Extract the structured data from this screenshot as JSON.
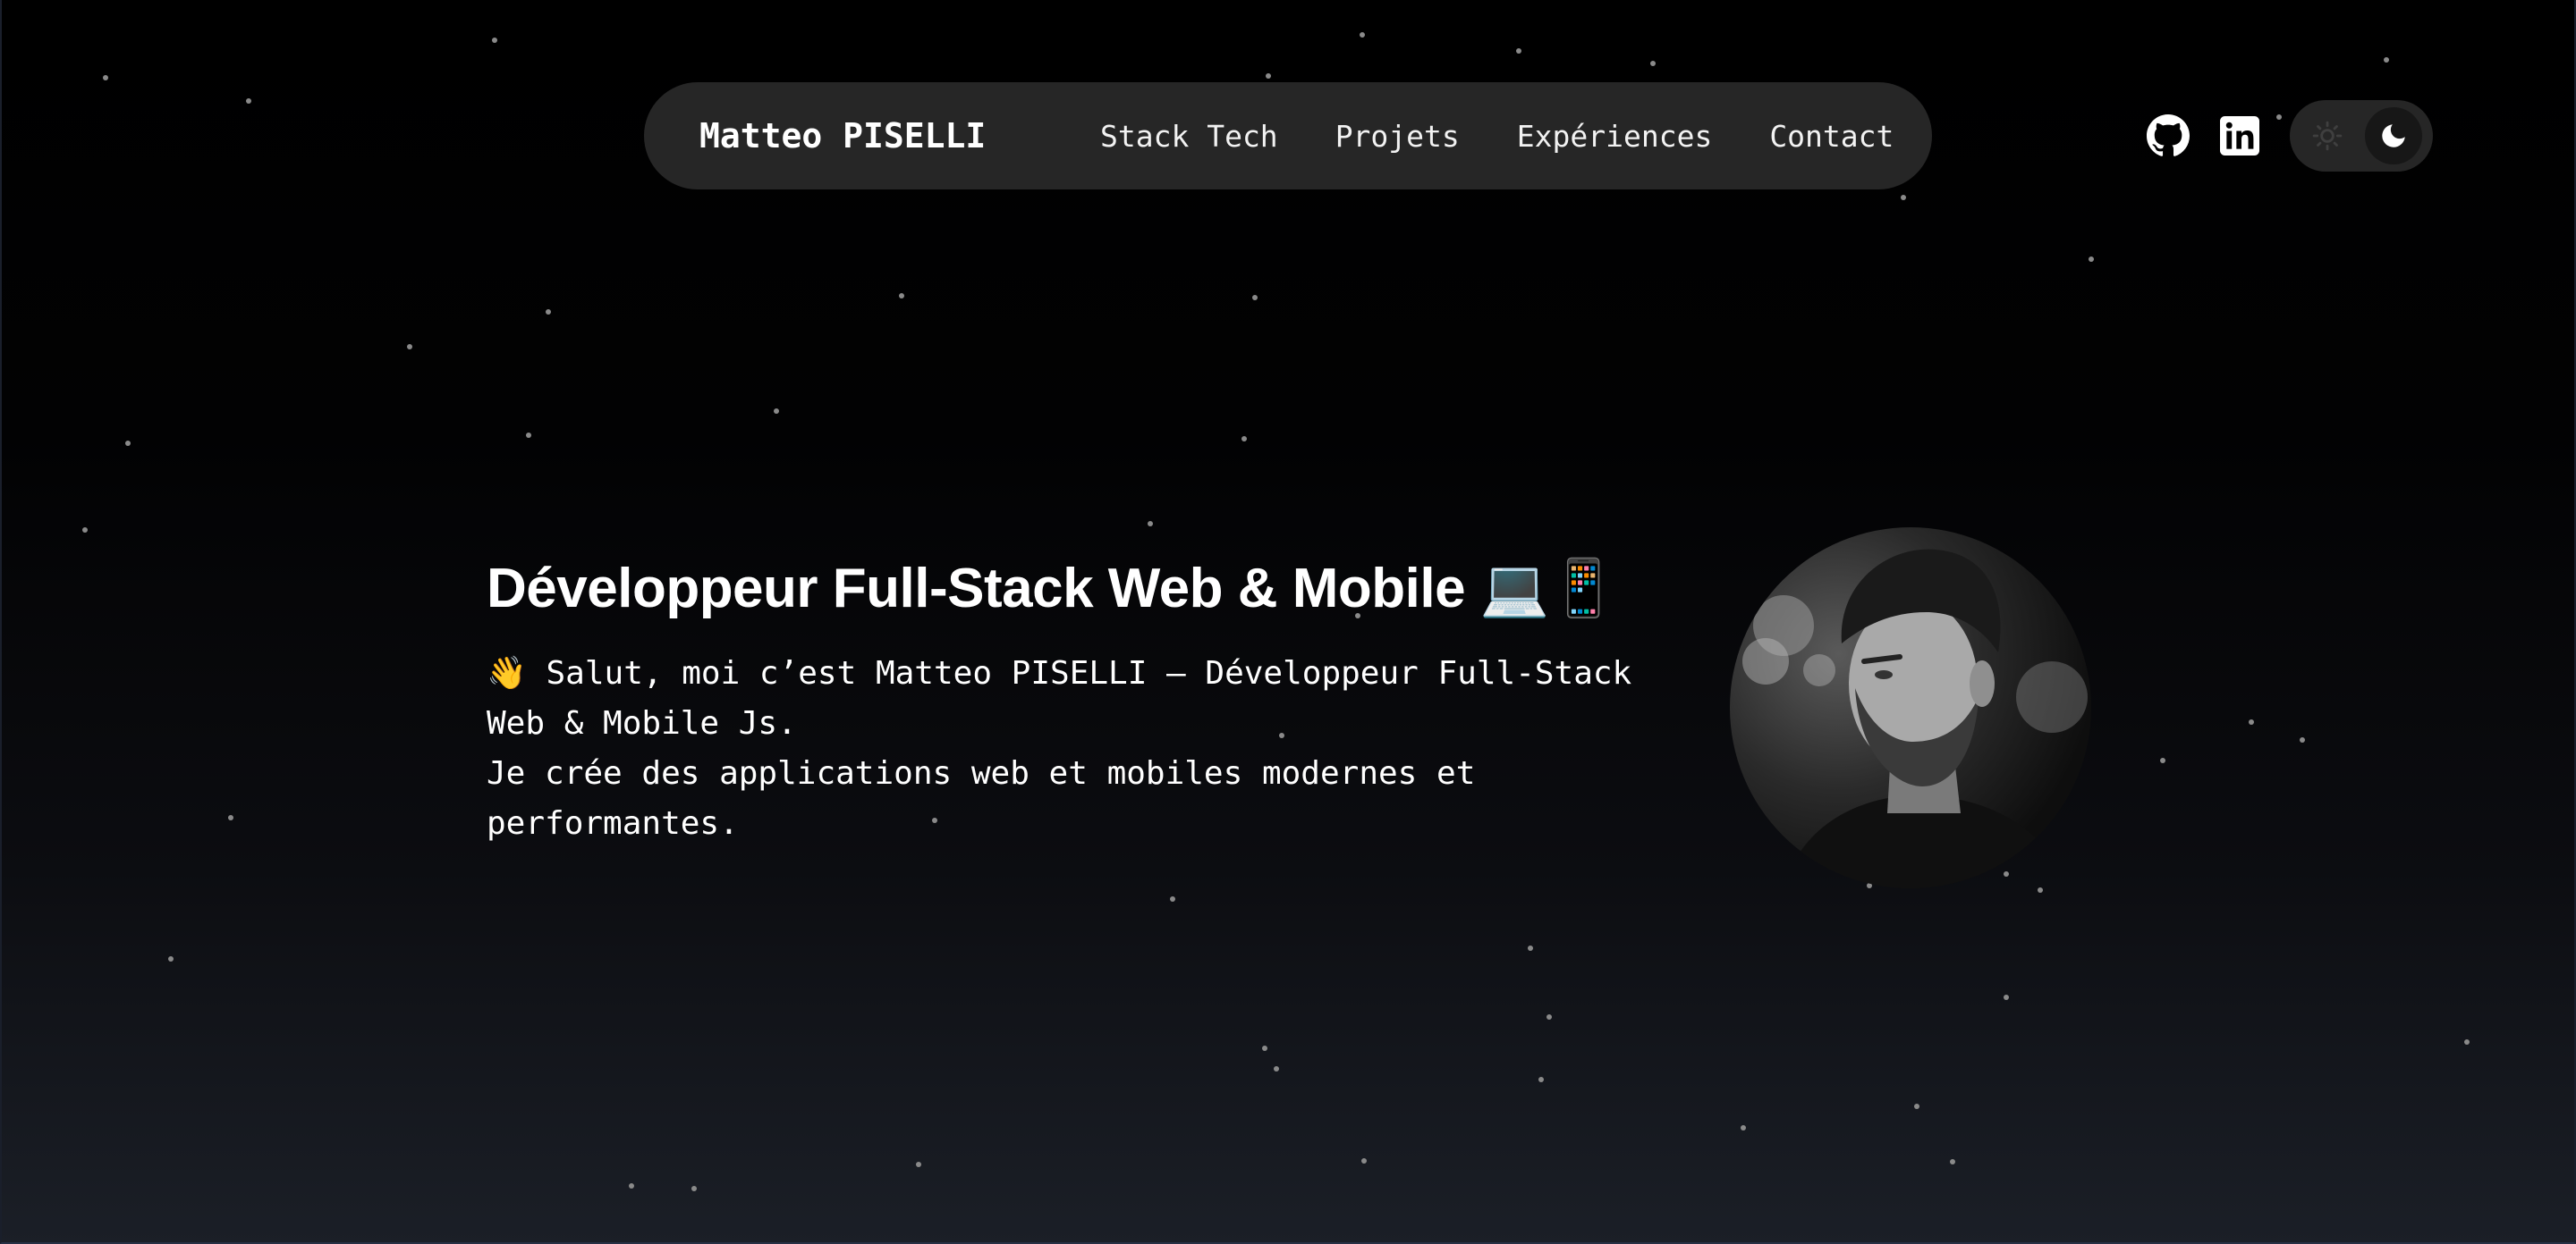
{
  "nav": {
    "brand": "Matteo PISELLI",
    "links": [
      "Stack Tech",
      "Projets",
      "Expériences",
      "Contact"
    ]
  },
  "header_icons": {
    "github": "github-icon",
    "linkedin": "linkedin-icon",
    "theme_light": "sun-icon",
    "theme_dark": "moon-icon"
  },
  "hero": {
    "title": "Développeur Full-Stack Web & Mobile 💻📱",
    "lines": [
      "👋 Salut, moi c’est Matteo PISELLI – Développeur Full-Stack",
      "Web & Mobile Js.",
      "Je crée des applications web et mobiles modernes et",
      "performantes."
    ]
  },
  "colors": {
    "background_top": "#000000",
    "background_bottom": "#1b1f27",
    "nav_pill": "#262626",
    "text": "#ffffff"
  }
}
